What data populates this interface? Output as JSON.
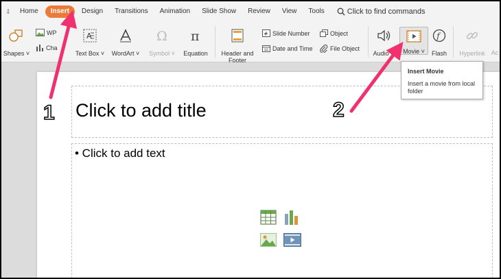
{
  "menu": {
    "toggle": "⇩",
    "tabs": [
      "Home",
      "Insert",
      "Design",
      "Transitions",
      "Animation",
      "Slide Show",
      "Review",
      "View",
      "Tools"
    ],
    "active_tab": "Insert",
    "find": "Click to find commands"
  },
  "ribbon": {
    "shapes": "Shapes",
    "wps_art": "WP",
    "chart": "Cha",
    "text_box": "Text Box",
    "wordart": "WordArt",
    "symbol": "Symbol",
    "equation": "Equation",
    "header_footer": "Header and Footer",
    "slide_number": "Slide Number",
    "date_time": "Date and Time",
    "object": "Object",
    "file_object": "File Object",
    "audio": "Audio",
    "movie": "Movie",
    "flash": "Flash",
    "hyperlink": "Hyperlink",
    "action": "Ac"
  },
  "tooltip": {
    "title": "Insert Movie",
    "description": "Insert a movie from local folder"
  },
  "slide": {
    "title_placeholder": "Click to add title",
    "body_placeholder": "• Click to add text"
  },
  "annotations": {
    "step1": "1",
    "step2": "2",
    "arrow_color": "#f0306f"
  },
  "colors": {
    "active_tab": "#ea7a3a"
  }
}
